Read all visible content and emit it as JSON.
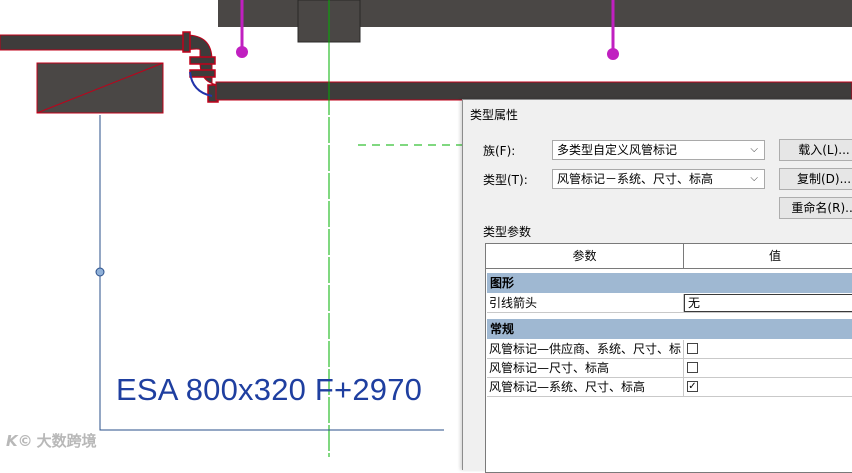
{
  "canvas": {
    "tag_text": "ESA 800x320 F+2970",
    "watermark_logo": "K©",
    "watermark_text": "大数跨境"
  },
  "dialog": {
    "title": "类型属性",
    "family_label": "族(F):",
    "family_value": "多类型自定义风管标记",
    "type_label": "类型(T):",
    "type_value": "风管标记－系统、尺寸、标高",
    "load_button": "载入(L)...",
    "duplicate_button": "复制(D)...",
    "rename_button": "重命名(R)...",
    "type_params_label": "类型参数",
    "columns": {
      "param": "参数",
      "value": "值"
    },
    "groups": {
      "graphics": {
        "label": "图形",
        "rows": [
          {
            "name": "引线箭头",
            "value": "无"
          }
        ]
      },
      "general": {
        "label": "常规",
        "rows": [
          {
            "name": "风管标记—供应商、系统、尺寸、标",
            "checked": false
          },
          {
            "name": "风管标记—尺寸、标高",
            "checked": false
          },
          {
            "name": "风管标记—系统、尺寸、标高",
            "checked": true,
            "check_glyph": "✓"
          }
        ]
      }
    }
  },
  "colors": {
    "duct": "#454240",
    "duct_outline": "#c0001a",
    "hanger": "#c020c0",
    "guide": "#00b000",
    "leader": "#2a4f8a",
    "tag": "#1f3fa0",
    "group_header": "#9fb8d2"
  }
}
